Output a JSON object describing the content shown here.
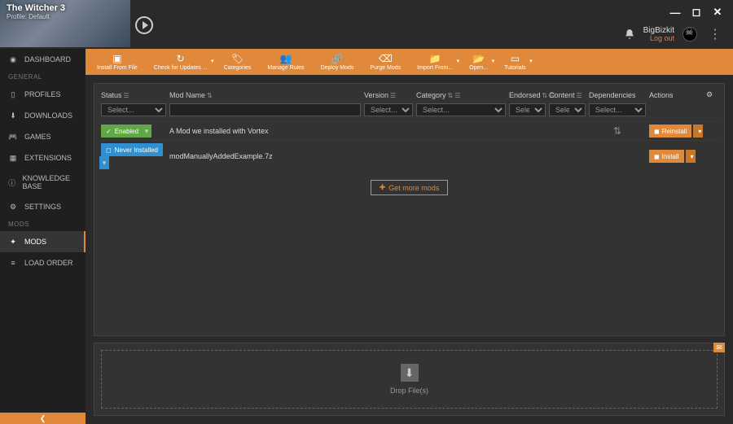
{
  "window": {
    "minimize": "—",
    "maximize": "◻",
    "close": "✕"
  },
  "game": {
    "title": "The Witcher 3",
    "profile": "Profile: Default"
  },
  "user": {
    "name": "BigBizkit",
    "logout": "Log out"
  },
  "sidebar": {
    "items": [
      {
        "label": "DASHBOARD",
        "icon": "◉"
      },
      {
        "header": "GENERAL"
      },
      {
        "label": "PROFILES",
        "icon": "▯"
      },
      {
        "label": "DOWNLOADS",
        "icon": "⬇"
      },
      {
        "label": "GAMES",
        "icon": "🎮"
      },
      {
        "label": "EXTENSIONS",
        "icon": "▦"
      },
      {
        "label": "KNOWLEDGE BASE",
        "icon": "ⓘ"
      },
      {
        "label": "SETTINGS",
        "icon": "⚙"
      },
      {
        "header": "MODS"
      },
      {
        "label": "MODS",
        "icon": "✦",
        "active": true
      },
      {
        "label": "LOAD ORDER",
        "icon": "≡"
      }
    ]
  },
  "toolbar": [
    {
      "label": "Install From File",
      "icon": "▣"
    },
    {
      "label": "Check for Updates ...",
      "icon": "↻",
      "dropdown": true
    },
    {
      "label": "Categories",
      "icon": "🏷"
    },
    {
      "label": "Manage Rules",
      "icon": "👥"
    },
    {
      "label": "Deploy Mods",
      "icon": "🔗"
    },
    {
      "label": "Purge Mods",
      "icon": "⌫"
    },
    {
      "label": "Import From...",
      "icon": "📁",
      "dropdown": true
    },
    {
      "label": "Open...",
      "icon": "📂",
      "dropdown": true
    },
    {
      "label": "Tutorials",
      "icon": "▭",
      "dropdown": true
    }
  ],
  "columns": {
    "status": "Status",
    "name": "Mod Name",
    "version": "Version",
    "category": "Category",
    "endorsed": "Endorsed",
    "content": "Content",
    "deps": "Dependencies",
    "actions": "Actions"
  },
  "filters": {
    "select": "Select...",
    "selectShort": "Selec"
  },
  "rows": [
    {
      "status": "Enabled",
      "statusColor": "green",
      "statusIcon": "✓",
      "name": "A Mod we installed with Vortex",
      "dep": true,
      "action": "Reinstall",
      "actionIcon": "◼"
    },
    {
      "status": "Never Installed",
      "statusColor": "blue",
      "statusIcon": "◻",
      "name": "modManuallyAddedExample.7z",
      "dep": false,
      "action": "Install",
      "actionIcon": "◼"
    }
  ],
  "getMore": "Get more mods",
  "dropzone": "Drop File(s)"
}
